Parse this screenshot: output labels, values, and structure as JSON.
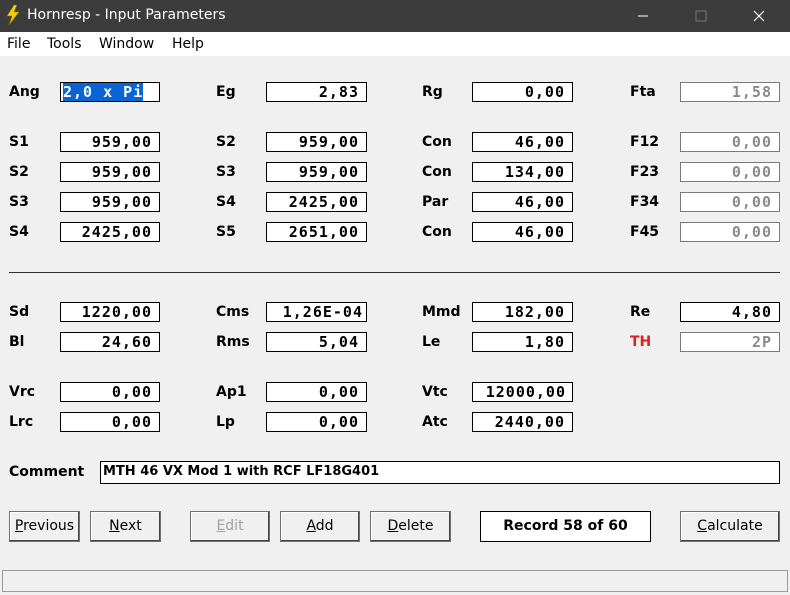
{
  "window": {
    "title": "Hornresp - Input Parameters"
  },
  "menu": [
    "File",
    "Tools",
    "Window",
    "Help"
  ],
  "fields": {
    "ang": {
      "label": "Ang",
      "value": "2,0 x Pi"
    },
    "eg": {
      "label": "Eg",
      "value": "2,83"
    },
    "rg": {
      "label": "Rg",
      "value": "0,00"
    },
    "fta": {
      "label": "Fta",
      "value": "1,58"
    },
    "s1": {
      "label": "S1",
      "value": "959,00"
    },
    "s2a": {
      "label": "S2",
      "value": "959,00"
    },
    "con1": {
      "label": "Con",
      "value": "46,00"
    },
    "f12": {
      "label": "F12",
      "value": "0,00"
    },
    "s2b": {
      "label": "S2",
      "value": "959,00"
    },
    "s3a": {
      "label": "S3",
      "value": "959,00"
    },
    "con2": {
      "label": "Con",
      "value": "134,00"
    },
    "f23": {
      "label": "F23",
      "value": "0,00"
    },
    "s3b": {
      "label": "S3",
      "value": "959,00"
    },
    "s4a": {
      "label": "S4",
      "value": "2425,00"
    },
    "par": {
      "label": "Par",
      "value": "46,00"
    },
    "f34": {
      "label": "F34",
      "value": "0,00"
    },
    "s4b": {
      "label": "S4",
      "value": "2425,00"
    },
    "s5": {
      "label": "S5",
      "value": "2651,00"
    },
    "con3": {
      "label": "Con",
      "value": "46,00"
    },
    "f45": {
      "label": "F45",
      "value": "0,00"
    },
    "sd": {
      "label": "Sd",
      "value": "1220,00"
    },
    "cms": {
      "label": "Cms",
      "value": "1,26E-04"
    },
    "mmd": {
      "label": "Mmd",
      "value": "182,00"
    },
    "re": {
      "label": "Re",
      "value": "4,80"
    },
    "bl": {
      "label": "Bl",
      "value": "24,60"
    },
    "rms": {
      "label": "Rms",
      "value": "5,04"
    },
    "le": {
      "label": "Le",
      "value": "1,80"
    },
    "th": {
      "label": "TH",
      "value": "2P"
    },
    "vrc": {
      "label": "Vrc",
      "value": "0,00"
    },
    "ap1": {
      "label": "Ap1",
      "value": "0,00"
    },
    "vtc": {
      "label": "Vtc",
      "value": "12000,00"
    },
    "lrc": {
      "label": "Lrc",
      "value": "0,00"
    },
    "lp": {
      "label": "Lp",
      "value": "0,00"
    },
    "atc": {
      "label": "Atc",
      "value": "2440,00"
    }
  },
  "comment": {
    "label": "Comment",
    "value": "MTH 46 VX Mod 1 with RCF LF18G401"
  },
  "buttons": {
    "previous": {
      "accel": "P",
      "rest": "revious"
    },
    "next": {
      "accel": "N",
      "rest": "ext"
    },
    "edit": {
      "accel": "E",
      "rest": "dit"
    },
    "add": {
      "accel": "A",
      "rest": "dd"
    },
    "delete": {
      "accel": "D",
      "rest": "elete"
    },
    "calculate": {
      "accel": "C",
      "rest": "alculate"
    }
  },
  "record": "Record 58 of 60",
  "colors": {
    "titlebar": "#3c3c3c",
    "selection": "#0a64d6",
    "th_label": "#e02020",
    "icon": "#f5d000"
  }
}
